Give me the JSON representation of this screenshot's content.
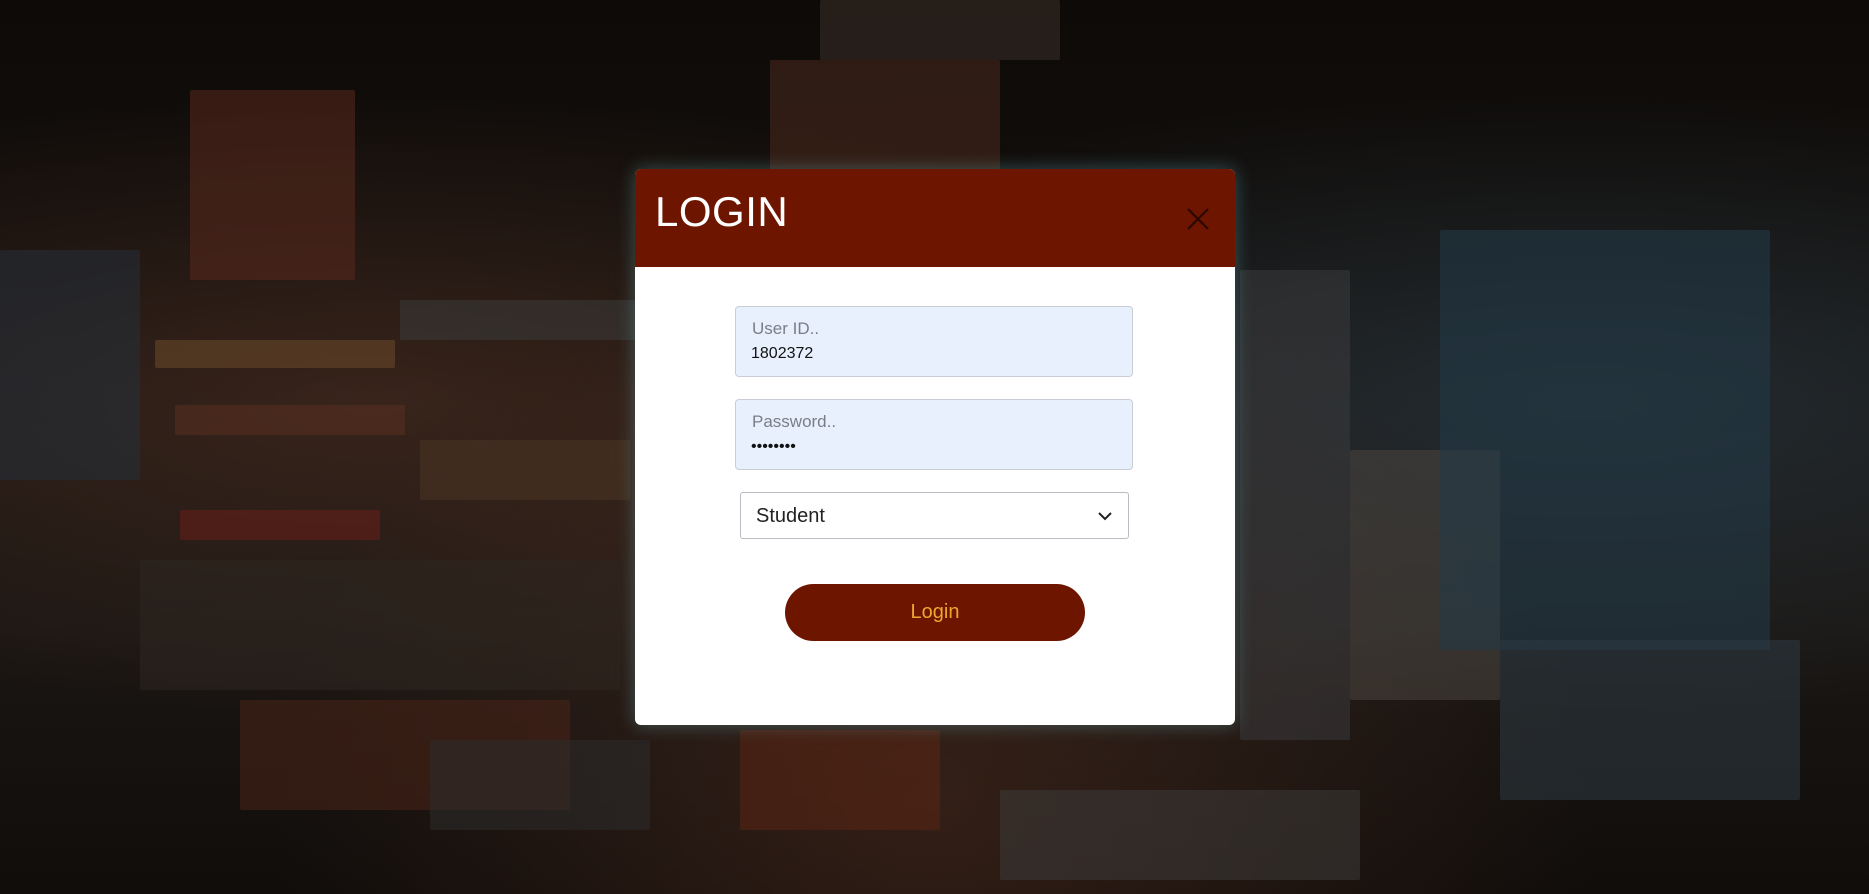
{
  "modal": {
    "title": "LOGIN",
    "close_icon": "close-icon"
  },
  "form": {
    "user_id": {
      "label": "User ID..",
      "value": "1802372"
    },
    "password": {
      "label": "Password..",
      "value": "••••••••"
    },
    "role": {
      "selected": "Student",
      "icon": "chevron-down-icon"
    },
    "submit_label": "Login"
  },
  "colors": {
    "header_bg": "#6e1500",
    "button_bg": "#6e1500",
    "button_text": "#f0a531",
    "input_bg": "#e8f0fe"
  }
}
